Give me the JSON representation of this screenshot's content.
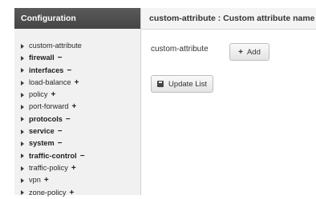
{
  "sidebar": {
    "title": "Configuration",
    "items": [
      {
        "label": "custom-attribute",
        "action": ""
      },
      {
        "label": "firewall",
        "action": "−"
      },
      {
        "label": "interfaces",
        "action": "−"
      },
      {
        "label": "load-balance",
        "action": "+"
      },
      {
        "label": "policy",
        "action": "+"
      },
      {
        "label": "port-forward",
        "action": "+"
      },
      {
        "label": "protocols",
        "action": "−"
      },
      {
        "label": "service",
        "action": "−"
      },
      {
        "label": "system",
        "action": "−"
      },
      {
        "label": "traffic-control",
        "action": "−"
      },
      {
        "label": "traffic-policy",
        "action": "+"
      },
      {
        "label": "vpn",
        "action": "+"
      },
      {
        "label": "zone-policy",
        "action": "+"
      }
    ]
  },
  "main": {
    "title": "custom-attribute : Custom attribute name",
    "field_label": "custom-attribute",
    "add_plus": "+",
    "add_label": "Add",
    "update_label": "Update List"
  }
}
